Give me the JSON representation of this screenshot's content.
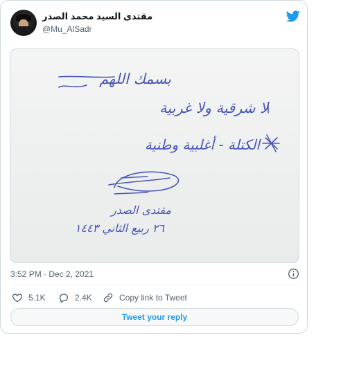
{
  "author": {
    "display_name": "مقتدى السيد محمد الصدر",
    "handle": "@Mu_AlSadr"
  },
  "media": {
    "handwriting_lines": [
      "بسمك اللهم",
      "لا شرقية ولا غربية",
      "الكتلة - أغلبية وطنية",
      "مقتدى الصدر",
      "٢٦ ربيع الثاني ١٤٤٣"
    ],
    "ink_color": "#4a56b8"
  },
  "timestamp": "3:52 PM · Dec 2, 2021",
  "actions": {
    "likes": "5.1K",
    "replies": "2.4K",
    "copy_link": "Copy link to Tweet"
  },
  "reply_button": "Tweet your reply",
  "colors": {
    "brand_blue": "#1d9bf0",
    "like_red": "#f91880"
  }
}
